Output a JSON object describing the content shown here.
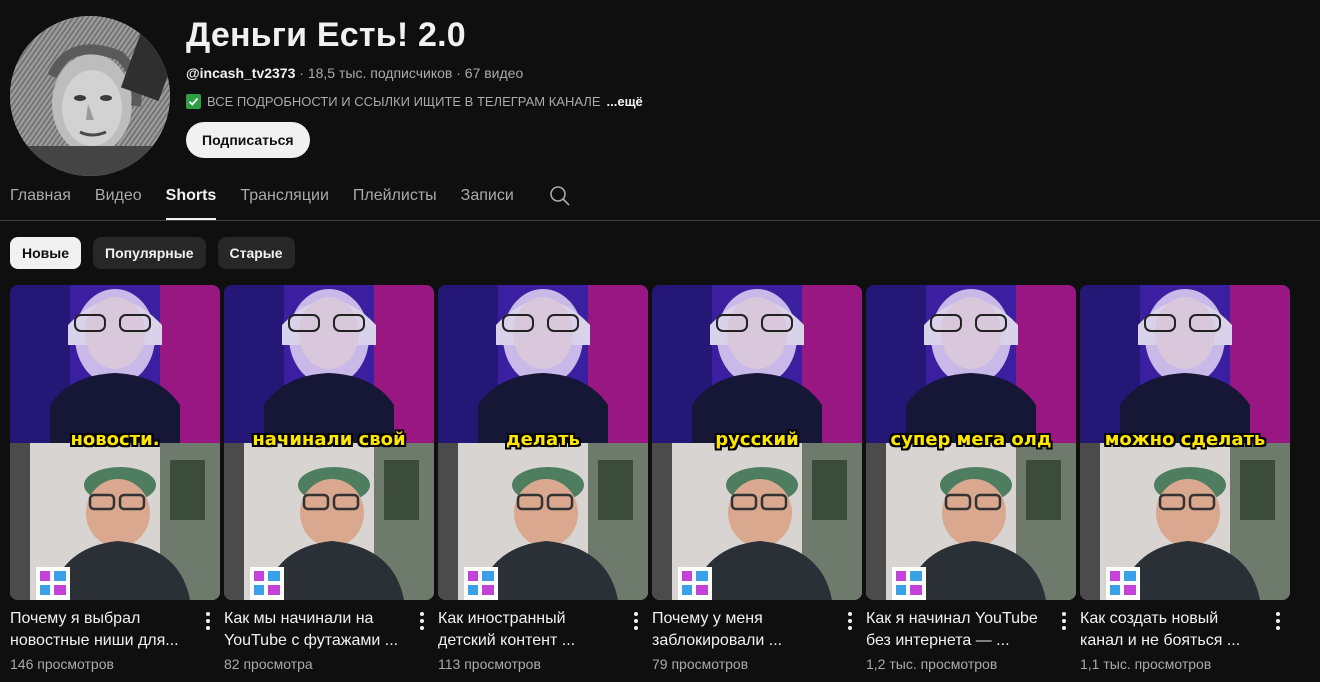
{
  "channel": {
    "title": "Деньги Есть! 2.0",
    "handle": "@incash_tv2373",
    "subscribers": "18,5 тыс. подписчиков",
    "video_count": "67 видео",
    "separator": "·",
    "description": "ВСЕ ПОДРОБНОСТИ И ССЫЛКИ ИЩИТЕ В ТЕЛЕГРАМ КАНАЛЕ",
    "more_label": "...ещё",
    "subscribe_label": "Подписаться",
    "avatar_icon": "avatar-banknote-portrait"
  },
  "tabs": [
    {
      "label": "Главная",
      "active": false
    },
    {
      "label": "Видео",
      "active": false
    },
    {
      "label": "Shorts",
      "active": true
    },
    {
      "label": "Трансляции",
      "active": false
    },
    {
      "label": "Плейлисты",
      "active": false
    },
    {
      "label": "Записи",
      "active": false
    }
  ],
  "search_icon": "search-icon",
  "chips": [
    {
      "label": "Новые",
      "active": true
    },
    {
      "label": "Популярные",
      "active": false
    },
    {
      "label": "Старые",
      "active": false
    }
  ],
  "shorts": [
    {
      "caption": "новости.",
      "title": "Почему я выбрал новостные ниши для...",
      "views": "146 просмотров"
    },
    {
      "caption": "начинали свой",
      "title": "Как мы начинали на YouTube с футажами ...",
      "views": "82 просмотра"
    },
    {
      "caption": "делать",
      "title": "Как иностранный детский контент ...",
      "views": "113 просмотров"
    },
    {
      "caption": "русский",
      "title": "Почему у меня заблокировали ...",
      "views": "79 просмотров"
    },
    {
      "caption": "супер мега олд",
      "title": "Как я начинал YouTube без интернета — ...",
      "views": "1,2 тыс. просмотров"
    },
    {
      "caption": "можно сделать",
      "title": "Как создать новый канал и не бояться ...",
      "views": "1,1 тыс. просмотров"
    }
  ],
  "colors": {
    "background": "#0f0f0f",
    "text": "#f1f1f1",
    "muted": "#aaaaaa",
    "caption": "#ffe600",
    "check": "#2ea043"
  }
}
